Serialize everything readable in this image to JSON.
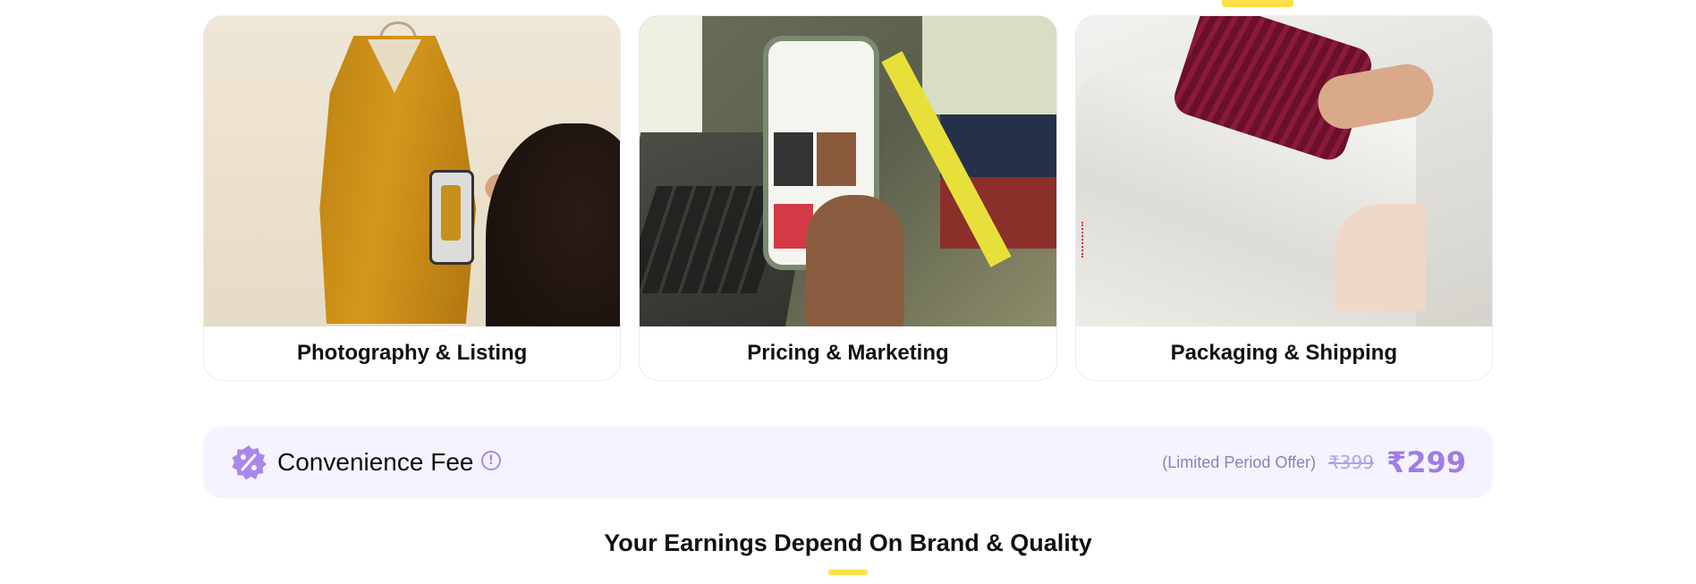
{
  "services": [
    {
      "label": "Photography & Listing",
      "image": "photo of mustard dress on hanger being photographed with phone"
    },
    {
      "label": "Pricing & Marketing",
      "image": "photo of phone showing FreeUp listing app beside laptop"
    },
    {
      "label": "Packaging & Shipping",
      "image": "photo of garment being packed into courier bag"
    }
  ],
  "fee": {
    "title": "Convenience Fee",
    "note": "(Limited Period Offer)",
    "original_price": "₹399",
    "price": "₹299",
    "colors": {
      "background": "#f5f3ff",
      "accent": "#9f7ce8"
    }
  },
  "earnings": {
    "title": "Your Earnings Depend On Brand & Quality"
  },
  "colors": {
    "highlight": "#fde047"
  }
}
